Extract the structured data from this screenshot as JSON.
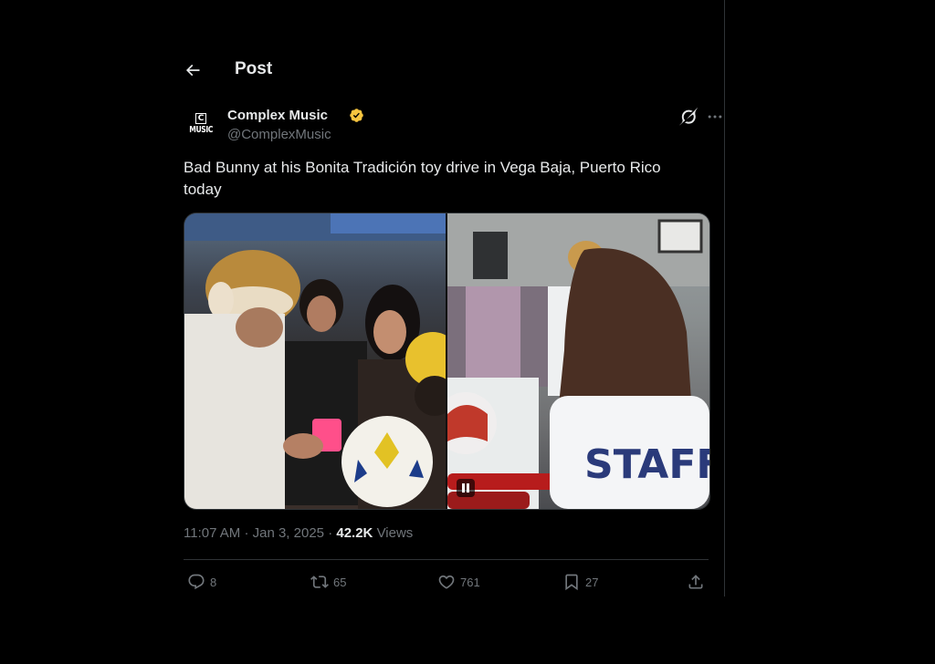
{
  "header": {
    "title": "Post",
    "back_icon": "arrow-left-icon"
  },
  "author": {
    "name": "Complex Music",
    "handle": "@ComplexMusic",
    "avatar_text_top": "C",
    "avatar_text_bottom": "MUSIC",
    "verified": true,
    "verified_color": "#f7c53f"
  },
  "post": {
    "text": "Bad Bunny at his Bonita Tradición toy drive in Vega Baja, Puerto Rico today",
    "media": [
      {
        "kind": "video",
        "state": "playing"
      },
      {
        "kind": "photo"
      }
    ]
  },
  "meta": {
    "time": "11:07 AM",
    "date": "Jan 3, 2025",
    "separator": "·",
    "views_count": "42.2K",
    "views_label": "Views"
  },
  "actions": {
    "replies": "8",
    "reposts": "65",
    "likes": "761",
    "bookmarks": "27"
  },
  "colors": {
    "background": "#000000",
    "text_primary": "#e7e9ea",
    "text_secondary": "#71767b",
    "border": "#2f3336"
  }
}
